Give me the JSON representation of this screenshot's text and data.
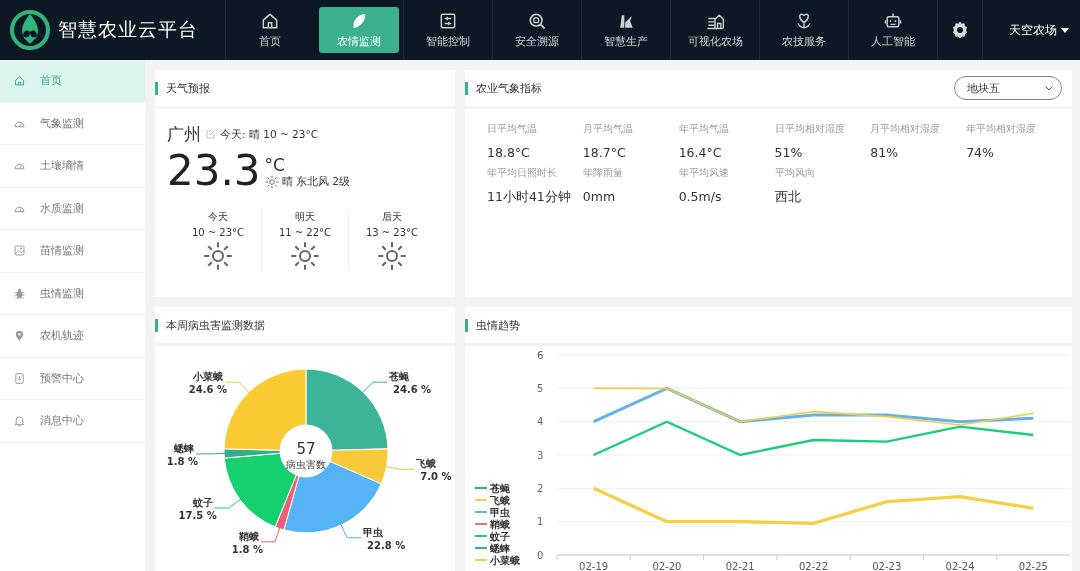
{
  "header": {
    "brand": "智慧农业云平台",
    "nav": [
      {
        "label": "首页",
        "selected": false
      },
      {
        "label": "农情监测",
        "selected": true
      },
      {
        "label": "智能控制",
        "selected": false
      },
      {
        "label": "安全溯源",
        "selected": false
      },
      {
        "label": "智慧生产",
        "selected": false
      },
      {
        "label": "可视化农场",
        "selected": false
      },
      {
        "label": "农技服务",
        "selected": false
      },
      {
        "label": "人工智能",
        "selected": false
      }
    ],
    "farm": "天空农场"
  },
  "sidebar": {
    "items": [
      {
        "label": "首页",
        "selected": true
      },
      {
        "label": "气象监测",
        "selected": false
      },
      {
        "label": "土壤墒情",
        "selected": false
      },
      {
        "label": "水质监测",
        "selected": false
      },
      {
        "label": "苗情监测",
        "selected": false
      },
      {
        "label": "虫情监测",
        "selected": false
      },
      {
        "label": "农机轨迹",
        "selected": false
      },
      {
        "label": "预警中心",
        "selected": false
      },
      {
        "label": "消息中心",
        "selected": false
      }
    ]
  },
  "weather": {
    "title": "天气预报",
    "city": "广州",
    "today_summary": "今天: 晴 10 ~ 23°C",
    "temperature": "23.3",
    "unit": "°C",
    "condition": "晴 东北风 2级",
    "forecast": [
      {
        "day": "今天",
        "range": "10 ~ 23°C"
      },
      {
        "day": "明天",
        "range": "11 ~ 22°C"
      },
      {
        "day": "后天",
        "range": "13 ~ 23°C"
      }
    ]
  },
  "indicators": {
    "title": "农业气象指标",
    "plot_select": "地块五",
    "items": [
      {
        "label": "日平均气温",
        "value": "18.8°C"
      },
      {
        "label": "月平均气温",
        "value": "18.7°C"
      },
      {
        "label": "年平均气温",
        "value": "16.4°C"
      },
      {
        "label": "日平均相对湿度",
        "value": "51%"
      },
      {
        "label": "月平均相对湿度",
        "value": "81%"
      },
      {
        "label": "年平均相对湿度",
        "value": "74%"
      },
      {
        "label": "年平均日照时长",
        "value": "11小时41分钟"
      },
      {
        "label": "年降雨量",
        "value": "0mm"
      },
      {
        "label": "年平均风速",
        "value": "0.5m/s"
      },
      {
        "label": "平均风向",
        "value": "西北"
      }
    ]
  },
  "pests": {
    "title": "本周病虫害监测数据",
    "total": "57",
    "total_label": "病虫害数",
    "chart_data": {
      "type": "donut",
      "categories": [
        "苍蝇",
        "飞蛾",
        "甲虫",
        "鞘蛾",
        "蚊子",
        "蟋蟀",
        "小菜蛾"
      ],
      "values": [
        24.6,
        7.0,
        22.8,
        1.8,
        17.5,
        1.8,
        24.6
      ],
      "colors": [
        "#3db39a",
        "#f9c93a",
        "#56b4f6",
        "#ec5f7a",
        "#16cf6e",
        "#35ad8a",
        "#fbcb34"
      ],
      "value_labels": [
        "24.6 %",
        "7.0 %",
        "22.8 %",
        "1.8 %",
        "17.5 %",
        "1.8 %",
        "24.6 %"
      ]
    }
  },
  "trend": {
    "title": "虫情趋势",
    "chart_data": {
      "type": "line",
      "categories": [
        "02-19",
        "02-20",
        "02-21",
        "02-22",
        "02-23",
        "02-24",
        "02-25"
      ],
      "ylim": [
        0,
        6
      ],
      "yticks": [
        0,
        1,
        2,
        3,
        4,
        5,
        6
      ],
      "grid": true,
      "legend": "bottom-left",
      "series": [
        {
          "name": "苍蝇",
          "color": "#3aa98c",
          "values": [
            null,
            null,
            null,
            null,
            null,
            null,
            null
          ]
        },
        {
          "name": "飞蛾",
          "color": "#f3cf4a",
          "values": [
            2,
            1,
            1,
            0.95,
            1.6,
            1.75,
            1.4
          ]
        },
        {
          "name": "甲虫",
          "color": "#62b2ee",
          "values": [
            4,
            5,
            4,
            4.2,
            4.2,
            4,
            4.1
          ]
        },
        {
          "name": "鞘蛾",
          "color": "#e8738c",
          "values": [
            null,
            null,
            null,
            null,
            null,
            null,
            null
          ]
        },
        {
          "name": "蚊子",
          "color": "#1ccc78",
          "values": [
            3,
            4,
            3,
            3.45,
            3.4,
            3.85,
            3.6
          ]
        },
        {
          "name": "蟋蟀",
          "color": "#2fb487",
          "values": [
            null,
            null,
            null,
            null,
            null,
            null,
            null
          ]
        },
        {
          "name": "小菜蛾",
          "color": "#f2cc45",
          "values": [
            5,
            5,
            4,
            4.3,
            4.15,
            3.9,
            4.25
          ]
        }
      ]
    }
  }
}
